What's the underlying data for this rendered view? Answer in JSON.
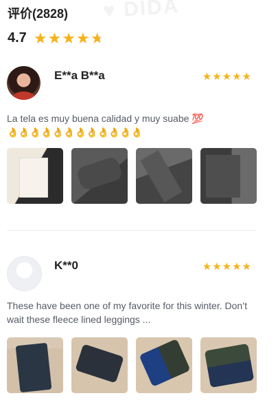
{
  "header": {
    "title": "评价(2828)"
  },
  "summary": {
    "rating": "4.7",
    "rating_value": 4.7,
    "stars_max": 5
  },
  "colors": {
    "star": "#f6b21a",
    "text_muted": "#555a66"
  },
  "reviews": [
    {
      "user": "E**a B**a",
      "stars": 5,
      "text": "La tela es muy buena calidad y muy suabe 💯",
      "emoji_line": "👌👌👌👌👌👌👌👌👌👌👌👌",
      "photo_count": 4
    },
    {
      "user": "K**0",
      "stars": 5,
      "text": "These have been one of my favorite for this winter. Don’t wait these fleece lined leggings ...",
      "photo_count": 4
    }
  ]
}
